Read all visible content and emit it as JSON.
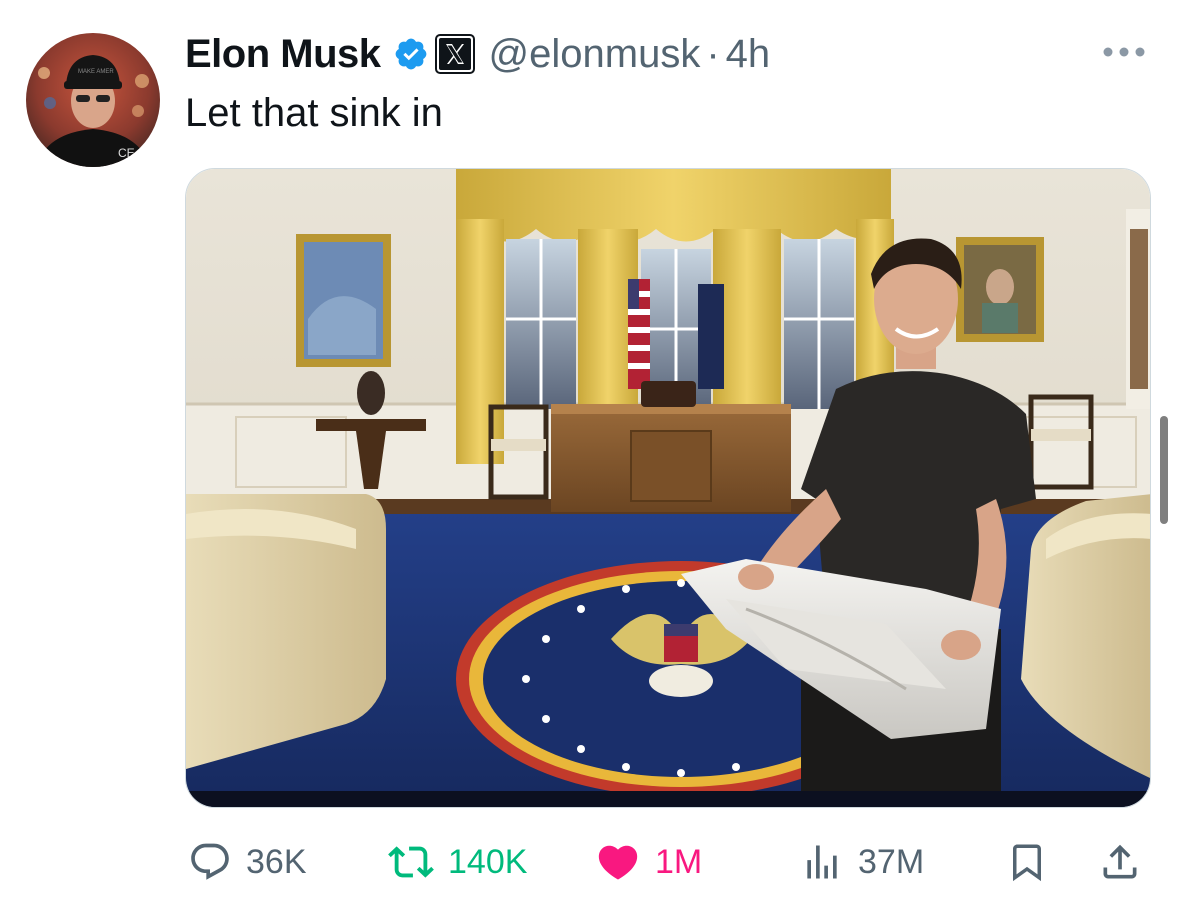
{
  "tweet": {
    "author": {
      "display_name": "Elon Musk",
      "handle": "@elonmusk",
      "verified": true,
      "affiliate_badge": "x-logo"
    },
    "separator": "·",
    "timestamp": "4h",
    "text": "Let that sink in",
    "media": {
      "type": "photo",
      "description_icon": "photo"
    },
    "actions": {
      "reply_count": "36K",
      "retweet_count": "140K",
      "like_count": "1M",
      "views_count": "37M"
    }
  },
  "colors": {
    "text_primary": "#0f1419",
    "text_secondary": "#536471",
    "verified_blue": "#1d9bf0",
    "retweet_green": "#00ba7c",
    "like_pink": "#f91880"
  },
  "icons": {
    "reply": "comment-bubble-icon",
    "retweet": "retweet-icon",
    "like": "heart-icon",
    "views": "bar-chart-icon",
    "bookmark": "bookmark-icon",
    "share": "share-icon",
    "more": "more-dots-icon",
    "verified": "verified-badge-icon",
    "affiliate": "x-logo-icon"
  }
}
